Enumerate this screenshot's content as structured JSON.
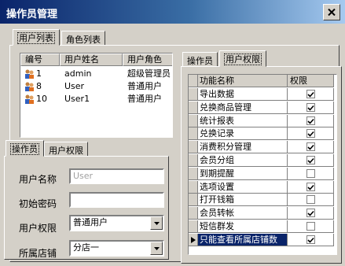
{
  "window": {
    "title": "操作员管理"
  },
  "outer_tabs": [
    {
      "label": "用户列表",
      "active": true
    },
    {
      "label": "角色列表",
      "active": false
    }
  ],
  "user_grid": {
    "columns": [
      "编号",
      "用户姓名",
      "用户角色"
    ],
    "rows": [
      {
        "id": "1",
        "name": "admin",
        "role": "超级管理员"
      },
      {
        "id": "8",
        "name": "User",
        "role": "普通用户"
      },
      {
        "id": "10",
        "name": "User1",
        "role": "普通用户"
      }
    ]
  },
  "detail_tabs": [
    {
      "label": "操作员",
      "active": true
    },
    {
      "label": "用户权限",
      "active": false
    }
  ],
  "form": {
    "username_label": "用户名称",
    "username_value": "User",
    "password_label": "初始密码",
    "password_value": "",
    "permission_label": "用户权限",
    "permission_value": "普通用户",
    "store_label": "所属店铺",
    "store_value": "分店一"
  },
  "right_tabs": [
    {
      "label": "操作员",
      "active": false
    },
    {
      "label": "用户权限",
      "active": true
    }
  ],
  "perm_grid": {
    "columns": [
      "功能名称",
      "权限"
    ],
    "rows": [
      {
        "name": "导出数据",
        "checked": true
      },
      {
        "name": "兑换商品管理",
        "checked": true
      },
      {
        "name": "统计报表",
        "checked": true
      },
      {
        "name": "兑换记录",
        "checked": true
      },
      {
        "name": "消费积分管理",
        "checked": true
      },
      {
        "name": "会员分组",
        "checked": true
      },
      {
        "name": "到期提醒",
        "checked": false
      },
      {
        "name": "选项设置",
        "checked": true
      },
      {
        "name": "打开钱箱",
        "checked": false
      },
      {
        "name": "会员转帐",
        "checked": true
      },
      {
        "name": "短信群发",
        "checked": false
      },
      {
        "name": "只能查看所属店铺数",
        "checked": true,
        "selected": true
      }
    ]
  }
}
